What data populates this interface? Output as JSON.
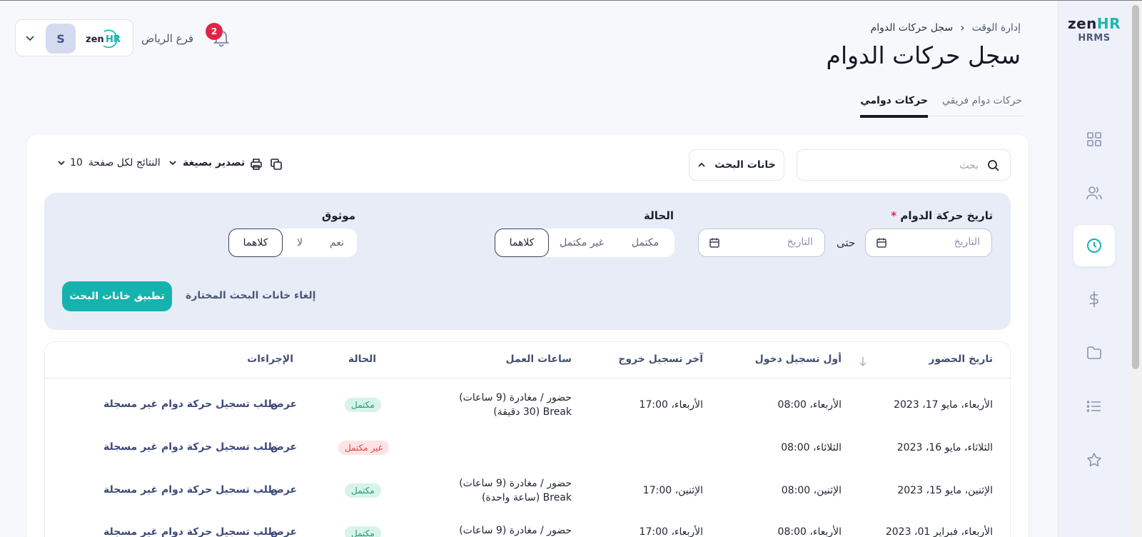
{
  "brand": {
    "name_part1": "zen",
    "name_part2": "HR",
    "product": "HRMS"
  },
  "sidebar": {
    "items": [
      {
        "icon": "dashboard-grid-icon"
      },
      {
        "icon": "users-icon"
      },
      {
        "icon": "clock-icon",
        "active": true
      },
      {
        "icon": "dollar-icon"
      },
      {
        "icon": "folder-icon"
      },
      {
        "icon": "list-icon"
      },
      {
        "icon": "star-icon"
      }
    ]
  },
  "header": {
    "breadcrumb": {
      "parent": "إدارة الوقت",
      "current": "سجل حركات الدوام"
    },
    "title": "سجل حركات الدوام",
    "tabs": [
      {
        "label": "حركات دوامي",
        "active": true
      },
      {
        "label": "حركات دوام فريقي",
        "active": false
      }
    ],
    "branch": "فرع الرياض",
    "notification_count": "2",
    "avatar_initial": "S"
  },
  "toolbar": {
    "search_placeholder": "بحث",
    "search_fields_label": "خانات البحث",
    "export_label": "تصدير بصيغة",
    "per_page_label": "النتائج لكل صفحة",
    "per_page_value": "10"
  },
  "filters": {
    "date_label": "تاريخ حركة الدوام",
    "required_mark": "*",
    "date_from_placeholder": "التاريخ",
    "until_label": "حتى",
    "date_to_placeholder": "التاريخ",
    "status_label": "الحالة",
    "status_options": [
      "مكتمل",
      "غير مكتمل",
      "كلاهما"
    ],
    "status_selected": "كلاهما",
    "trusted_label": "موثوق",
    "trusted_options": [
      "نعم",
      "لا",
      "كلاهما"
    ],
    "trusted_selected": "كلاهما",
    "apply_label": "تطبيق خانات البحث",
    "clear_label": "إلغاء خانات البحث المختارة"
  },
  "table": {
    "columns": [
      "تاريخ الحضور",
      "أول تسجيل دخول",
      "آخر تسجيل خروج",
      "ساعات العمل",
      "الحالة",
      "الإجراءات"
    ],
    "rows": [
      {
        "date": "الأربعاء، مايو 17، 2023",
        "first_in": "الأربعاء، 08:00",
        "last_out": "الأربعاء، 17:00",
        "hours_line1": "حضور / مغادرة (9 ساعات)",
        "hours_line2": "Break (30 دقيقة)",
        "status": "مكتمل",
        "status_type": "ok",
        "view": "عرض",
        "request": "طلب تسجيل حركة دوام غير مسجلة"
      },
      {
        "date": "الثلاثاء، مايو 16، 2023",
        "first_in": "الثلاثاء، 08:00",
        "last_out": "",
        "hours_line1": "",
        "hours_line2": "",
        "status": "غير مكتمل",
        "status_type": "bad",
        "view": "عرض",
        "request": "طلب تسجيل حركة دوام غير مسجلة"
      },
      {
        "date": "الإثنين، مايو 15، 2023",
        "first_in": "الإثنين، 08:00",
        "last_out": "الإثنين، 17:00",
        "hours_line1": "حضور / مغادرة (9 ساعات)",
        "hours_line2": "Break (ساعة واحدة)",
        "status": "مكتمل",
        "status_type": "ok",
        "view": "عرض",
        "request": "طلب تسجيل حركة دوام غير مسجلة"
      },
      {
        "date": "الأربعاء، فبراير 01، 2023",
        "first_in": "الأربعاء، 08:00",
        "last_out": "الأربعاء، 17:00",
        "hours_line1": "حضور / مغادرة (9 ساعات)",
        "hours_line2": "",
        "status": "مكتمل",
        "status_type": "ok",
        "view": "عرض",
        "request": "طلب تسجيل حركة دوام غير مسجلة"
      }
    ]
  }
}
